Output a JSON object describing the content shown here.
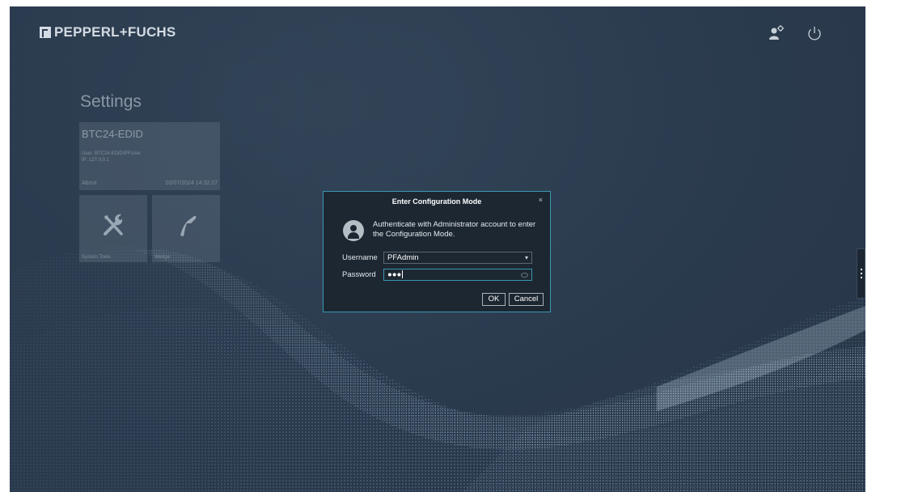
{
  "header": {
    "brand": "PEPPERL+FUCHS",
    "icons": [
      "user-admin-icon",
      "power-icon"
    ]
  },
  "settings": {
    "title": "Settings",
    "device_tile": {
      "name": "BTC24-EDID",
      "user": "User: BTC24-EDID\\PFUser",
      "ip": "IP: 127.0.0.1",
      "about": "About",
      "datetime": "02/07/2024 14:32:27"
    },
    "tiles": [
      {
        "label": "System Tools",
        "icon": "tools-icon"
      },
      {
        "label": "Wedge",
        "icon": "scanner-icon"
      }
    ]
  },
  "dialog": {
    "title": "Enter Configuration Mode",
    "close": "×",
    "message": "Authenticate with Administrator account to enter the Configuration Mode.",
    "username_label": "Username",
    "username_value": "PFAdmin",
    "password_label": "Password",
    "password_value": "●●●",
    "ok_label": "OK",
    "cancel_label": "Cancel"
  },
  "colors": {
    "accent": "#3a97b3",
    "background": "#2b3b4e",
    "dialog": "#1d2731"
  }
}
